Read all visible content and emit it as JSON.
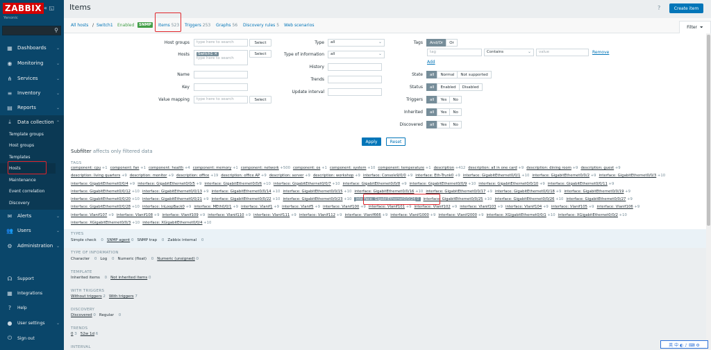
{
  "sidebar": {
    "logo": "ZABBIX",
    "sub": "Yenonic",
    "items": [
      {
        "label": "Dashboards",
        "icon": "dashboard-icon",
        "glyph": "▦"
      },
      {
        "label": "Monitoring",
        "icon": "eye-icon",
        "glyph": "◉"
      },
      {
        "label": "Services",
        "icon": "services-icon",
        "glyph": "⋔"
      },
      {
        "label": "Inventory",
        "icon": "list-icon",
        "glyph": "≡"
      },
      {
        "label": "Reports",
        "icon": "report-icon",
        "glyph": "▤"
      },
      {
        "label": "Data collection",
        "icon": "download-icon",
        "glyph": "⤓"
      }
    ],
    "sub_items": [
      "Template groups",
      "Host groups",
      "Templates",
      "Hosts",
      "Maintenance",
      "Event correlation",
      "Discovery"
    ],
    "bottom_items": [
      {
        "label": "Alerts",
        "icon": "alert-icon",
        "glyph": "✉"
      },
      {
        "label": "Users",
        "icon": "users-icon",
        "glyph": "👥"
      },
      {
        "label": "Administration",
        "icon": "gear-icon",
        "glyph": "⚙"
      }
    ],
    "footer_items": [
      {
        "label": "Support",
        "icon": "support-icon",
        "glyph": "☊"
      },
      {
        "label": "Integrations",
        "icon": "integrations-icon",
        "glyph": "▦"
      },
      {
        "label": "Help",
        "icon": "help-icon",
        "glyph": "?"
      },
      {
        "label": "User settings",
        "icon": "user-icon",
        "glyph": "●"
      },
      {
        "label": "Sign out",
        "icon": "power-icon",
        "glyph": "⏻"
      }
    ]
  },
  "header": {
    "title": "Items",
    "create_label": "Create item"
  },
  "breadcrumb": {
    "all_hosts": "All hosts",
    "sep": "/",
    "host": "Switch1",
    "enabled": "Enabled",
    "snmp": "SNMP",
    "items": "Items",
    "items_count": "523",
    "triggers": "Triggers",
    "triggers_count": "253",
    "graphs": "Graphs",
    "graphs_count": "56",
    "discovery": "Discovery rules",
    "discovery_count": "5",
    "web": "Web scenarios",
    "filter": "Filter"
  },
  "filter": {
    "host_groups_label": "Host groups",
    "host_groups_placeholder": "type here to search",
    "select": "Select",
    "hosts_label": "Hosts",
    "hosts_chip": "Switch1",
    "hosts_placeholder": "type here to search",
    "name_label": "Name",
    "key_label": "Key",
    "value_mapping_label": "Value mapping",
    "value_mapping_placeholder": "type here to search",
    "type_label": "Type",
    "type_value": "all",
    "type_info_label": "Type of information",
    "type_info_value": "all",
    "history_label": "History",
    "trends_label": "Trends",
    "update_label": "Update interval",
    "tags_label": "Tags",
    "andor": "And/Or",
    "or": "Or",
    "tag_placeholder": "tag",
    "contains": "Contains",
    "value_placeholder": "value",
    "remove": "Remove",
    "add": "Add",
    "state_label": "State",
    "state_opts": [
      "all",
      "Normal",
      "Not supported"
    ],
    "status_label": "Status",
    "status_opts": [
      "all",
      "Enabled",
      "Disabled"
    ],
    "triggers_label": "Triggers",
    "inherited_label": "Inherited",
    "discovered_label": "Discovered",
    "yesno": [
      "all",
      "Yes",
      "No"
    ],
    "apply": "Apply",
    "reset": "Reset"
  },
  "subfilter": {
    "title": "Subfilter",
    "note": "affects only filtered data",
    "tags_head": "TAGS",
    "tag_lines": [
      [
        [
          "component: cpu",
          "1"
        ],
        [
          "component: fan",
          "1"
        ],
        [
          "component: health",
          "4"
        ],
        [
          "component: memory",
          "1"
        ],
        [
          "component: network",
          "500"
        ],
        [
          "component: os",
          "1"
        ],
        [
          "component: system",
          "10"
        ],
        [
          "component: temperature",
          "1"
        ],
        [
          "description",
          "412"
        ],
        [
          "description: all in one card",
          "9"
        ],
        [
          "description: dining room",
          "9"
        ],
        [
          "description: guest",
          "9"
        ]
      ],
      [
        [
          "description: living quarters",
          "9"
        ],
        [
          "description: monitor",
          "9"
        ],
        [
          "description: office",
          "19"
        ],
        [
          "description: office AP",
          "9"
        ],
        [
          "description: server",
          "9"
        ],
        [
          "description: workshop",
          "9"
        ],
        [
          "interface: Console9/0/0",
          "9"
        ],
        [
          "interface: Eth-Trunk0",
          "9"
        ],
        [
          "interface: GigabitEthernet0/0/1",
          "10"
        ],
        [
          "interface: GigabitEthernet0/0/2",
          "9"
        ],
        [
          "interface: GigabitEthernet0/0/3",
          "10"
        ]
      ],
      [
        [
          "interface: GigabitEthernet0/0/4",
          "9"
        ],
        [
          "interface: GigabitEthernet0/0/5",
          "9"
        ],
        [
          "interface: GigabitEthernet0/0/6",
          "10"
        ],
        [
          "interface: GigabitEthernet0/0/7",
          "10"
        ],
        [
          "interface: GigabitEthernet0/0/8",
          "9"
        ],
        [
          "interface: GigabitEthernet0/0/9",
          "10"
        ],
        [
          "interface: GigabitEthernet0/0/10",
          "9"
        ],
        [
          "interface: GigabitEthernet0/0/11",
          "9"
        ]
      ],
      [
        [
          "interface: GigabitEthernet0/0/12",
          "10"
        ],
        [
          "interface: GigabitEthernet0/0/13",
          "9"
        ],
        [
          "interface: GigabitEthernet0/0/14",
          "10"
        ],
        [
          "interface: GigabitEthernet0/0/15",
          "10"
        ],
        [
          "interface: GigabitEthernet0/0/16",
          "10"
        ],
        [
          "interface: GigabitEthernet0/0/17",
          "9"
        ],
        [
          "interface: GigabitEthernet0/0/18",
          "9"
        ],
        [
          "interface: GigabitEthernet0/0/19",
          "9"
        ]
      ],
      [
        [
          "interface: GigabitEthernet0/0/20",
          "10"
        ],
        [
          "interface: GigabitEthernet0/0/21",
          "9"
        ],
        [
          "interface: GigabitEthernet0/0/22",
          "10"
        ],
        [
          "interface: GigabitEthernet0/0/23",
          "10"
        ],
        [
          "interface: GigabitEthernet0/0/24",
          "0"
        ],
        [
          "interface: GigabitEthernet0/0/25",
          "10"
        ],
        [
          "interface: GigabitEthernet0/0/26",
          "10"
        ],
        [
          "interface: GigabitEthernet0/0/27",
          "9"
        ]
      ],
      [
        [
          "interface: GigabitEthernet0/0/28",
          "10"
        ],
        [
          "interface: InLoopBack0",
          "9"
        ],
        [
          "interface: MEth0/0/1",
          "9"
        ],
        [
          "interface: Vlanif1",
          "9"
        ],
        [
          "interface: Vlanif5",
          "9"
        ],
        [
          "interface: Vlanif100",
          "9"
        ],
        [
          "interface: Vlanif101",
          "9"
        ],
        [
          "interface: Vlanif102",
          "9"
        ],
        [
          "interface: Vlanif103",
          "9"
        ],
        [
          "interface: Vlanif104",
          "9"
        ],
        [
          "interface: Vlanif105",
          "9"
        ],
        [
          "interface: Vlanif106",
          "9"
        ]
      ],
      [
        [
          "interface: Vlanif107",
          "9"
        ],
        [
          "interface: Vlanif108",
          "9"
        ],
        [
          "interface: Vlanif109",
          "9"
        ],
        [
          "interface: Vlanif110",
          "9"
        ],
        [
          "interface: Vlanif111",
          "9"
        ],
        [
          "interface: Vlanif112",
          "9"
        ],
        [
          "interface: Vlanif666",
          "9"
        ],
        [
          "interface: Vlanif1000",
          "9"
        ],
        [
          "interface: Vlanif2000",
          "9"
        ],
        [
          "interface: XGigabitEthernet0/0/1",
          "10"
        ],
        [
          "interface: XGigabitEthernet0/0/2",
          "10"
        ]
      ],
      [
        [
          "interface: XGigabitEthernet0/0/3",
          "10"
        ],
        [
          "interface: XGigabitEthernet0/0/4",
          "10"
        ]
      ]
    ],
    "selected_tag": "interface: GigabitEthernet0/0/24",
    "types_head": "TYPES",
    "types": [
      [
        "Simple check",
        "0",
        false
      ],
      [
        "SNMP agent",
        "0",
        true
      ],
      [
        "SNMP trap",
        "0",
        false
      ],
      [
        "Zabbix internal",
        "0",
        false
      ]
    ],
    "typeinfo_head": "TYPE OF INFORMATION",
    "typeinfo": [
      [
        "Character",
        "0",
        false
      ],
      [
        "Log",
        "0",
        false
      ],
      [
        "Numeric (float)",
        "0",
        false
      ],
      [
        "Numeric (unsigned)",
        "0",
        true
      ]
    ],
    "template_head": "TEMPLATE",
    "template": [
      [
        "Inherited items",
        "0",
        false
      ],
      [
        "Not inherited items",
        "0",
        true
      ]
    ],
    "withtrig_head": "WITH TRIGGERS",
    "withtrig": [
      [
        "Without triggers",
        "2",
        true
      ],
      [
        "With triggers",
        "7",
        true
      ]
    ],
    "discovery_head": "DISCOVERY",
    "discovery": [
      [
        "Discovered",
        "0",
        true
      ],
      [
        "Regular",
        "0",
        false
      ]
    ],
    "trends_head": "TRENDS",
    "trends": [
      [
        "0",
        "3",
        true
      ],
      [
        "52w 1d",
        "6",
        true
      ]
    ],
    "interval_head": "INTERVAL"
  },
  "ime": "英 中 ◐ ♪ ⌨ ⚙"
}
